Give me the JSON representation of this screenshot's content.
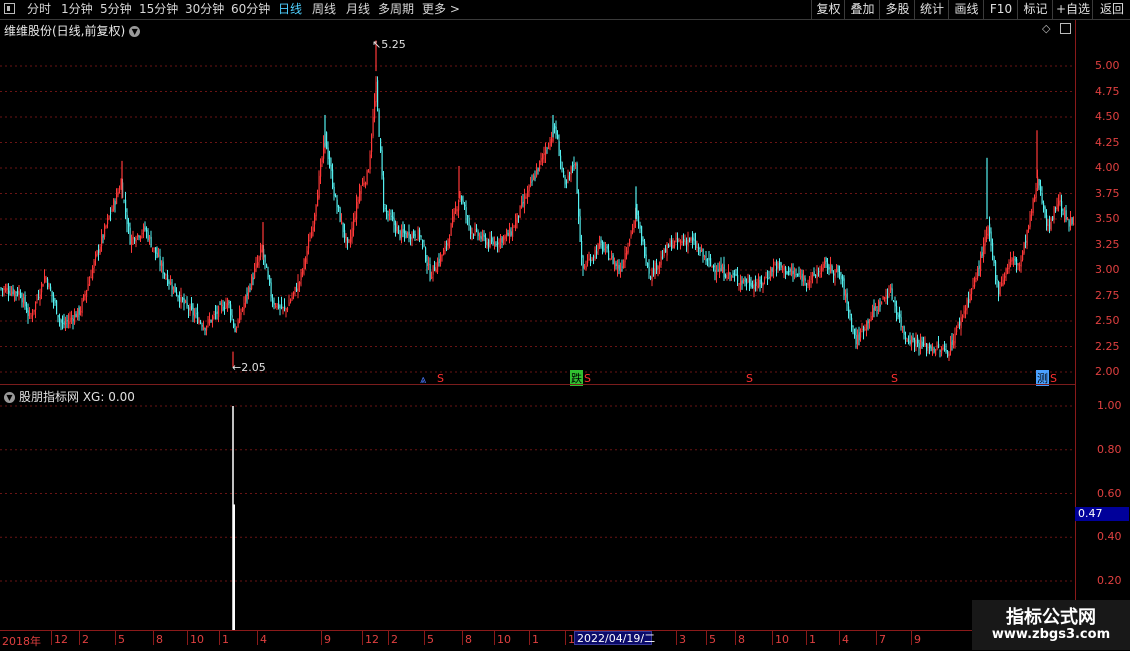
{
  "toolbar": {
    "tabs": [
      "分时",
      "1分钟",
      "5分钟",
      "15分钟",
      "30分钟",
      "60分钟",
      "日线",
      "周线",
      "月线",
      "多周期",
      "更多 >"
    ],
    "active_tab": "日线",
    "right_buttons": [
      "复权",
      "叠加",
      "多股",
      "统计",
      "画线",
      "F10",
      "标记",
      "+自选",
      "返回"
    ]
  },
  "main_panel": {
    "title": "维维股份(日线,前复权)",
    "high_label": "5.25",
    "low_label": "2.05",
    "y_ticks": [
      "5.00",
      "4.75",
      "4.50",
      "4.25",
      "4.00",
      "3.75",
      "3.50",
      "3.25",
      "3.00",
      "2.75",
      "2.50",
      "2.25",
      "2.00"
    ],
    "markers": [
      "S",
      "S",
      "跌",
      "S",
      "S",
      "S",
      "测",
      "S"
    ],
    "up_color": "#ff3838",
    "down_color": "#54f0f0"
  },
  "indicator_panel": {
    "title": "股朋指标网  XG: 0.00",
    "y_ticks": [
      "1.00",
      "0.80",
      "0.60",
      "0.40",
      "0.20"
    ],
    "current_value": "0.47"
  },
  "x_axis": {
    "labels": [
      "2018年",
      "12",
      "2",
      "5",
      "8",
      "10",
      "1",
      "4",
      "9",
      "12",
      "2",
      "5",
      "8",
      "10",
      "1",
      "12",
      "3",
      "5",
      "8",
      "10",
      "1",
      "4",
      "7",
      "9"
    ],
    "cursor_date": "2022/04/19/二"
  },
  "watermark": {
    "title": "指标公式网",
    "url": "www.zbgs3.com"
  }
}
